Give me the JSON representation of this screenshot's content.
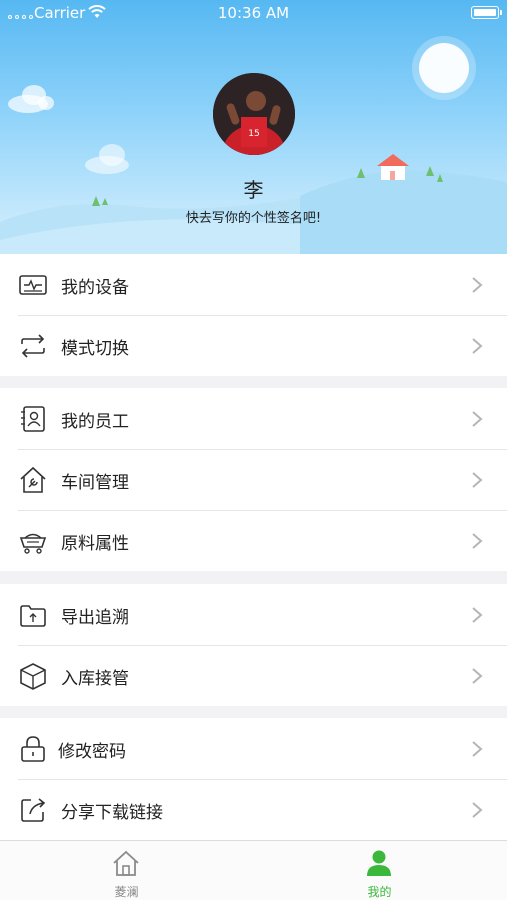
{
  "status_bar": {
    "carrier": "Carrier",
    "time": "10:36 AM"
  },
  "profile": {
    "name": "李",
    "signature": "快去写你的个性签名吧!"
  },
  "menu_groups": [
    {
      "items": [
        {
          "label": "我的设备",
          "icon": "monitor-icon"
        },
        {
          "label": "模式切换",
          "icon": "switch-arrows-icon"
        }
      ]
    },
    {
      "items": [
        {
          "label": "我的员工",
          "icon": "employee-card-icon"
        },
        {
          "label": "车间管理",
          "icon": "house-wrench-icon"
        },
        {
          "label": "原料属性",
          "icon": "cart-icon"
        }
      ]
    },
    {
      "items": [
        {
          "label": "导出追溯",
          "icon": "folder-upload-icon"
        },
        {
          "label": "入库接管",
          "icon": "box-icon"
        }
      ]
    },
    {
      "items": [
        {
          "label": "修改密码",
          "icon": "lock-icon"
        },
        {
          "label": "分享下载链接",
          "icon": "share-icon"
        }
      ]
    }
  ],
  "tabbar": {
    "home": {
      "label": "菱澜",
      "icon": "home-icon"
    },
    "mine": {
      "label": "我的",
      "icon": "person-icon",
      "active": true
    }
  },
  "colors": {
    "accent": "#3bb83b",
    "sky_top": "#56b8f2",
    "sky_bottom": "#d7f0fd",
    "hill": "#a9dcf6"
  }
}
